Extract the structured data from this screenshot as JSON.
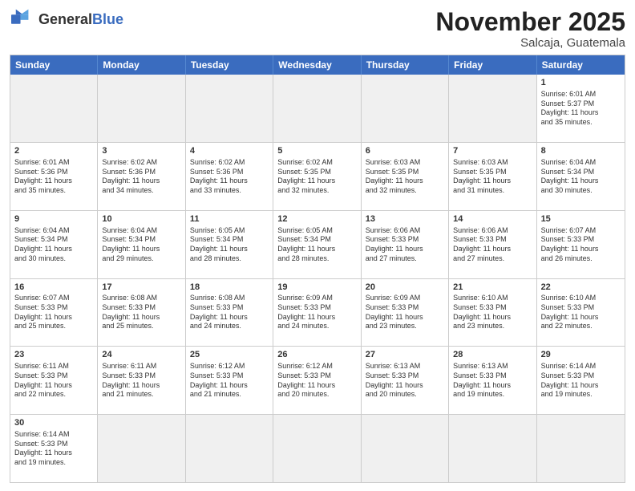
{
  "header": {
    "logo_general": "General",
    "logo_blue": "Blue",
    "month_title": "November 2025",
    "location": "Salcaja, Guatemala"
  },
  "days_of_week": [
    "Sunday",
    "Monday",
    "Tuesday",
    "Wednesday",
    "Thursday",
    "Friday",
    "Saturday"
  ],
  "weeks": [
    [
      {
        "day": "",
        "info": "",
        "shaded": true
      },
      {
        "day": "",
        "info": "",
        "shaded": true
      },
      {
        "day": "",
        "info": "",
        "shaded": true
      },
      {
        "day": "",
        "info": "",
        "shaded": true
      },
      {
        "day": "",
        "info": "",
        "shaded": true
      },
      {
        "day": "",
        "info": "",
        "shaded": true
      },
      {
        "day": "1",
        "info": "Sunrise: 6:01 AM\nSunset: 5:37 PM\nDaylight: 11 hours\nand 35 minutes.",
        "shaded": false
      }
    ],
    [
      {
        "day": "2",
        "info": "Sunrise: 6:01 AM\nSunset: 5:36 PM\nDaylight: 11 hours\nand 35 minutes.",
        "shaded": false
      },
      {
        "day": "3",
        "info": "Sunrise: 6:02 AM\nSunset: 5:36 PM\nDaylight: 11 hours\nand 34 minutes.",
        "shaded": false
      },
      {
        "day": "4",
        "info": "Sunrise: 6:02 AM\nSunset: 5:36 PM\nDaylight: 11 hours\nand 33 minutes.",
        "shaded": false
      },
      {
        "day": "5",
        "info": "Sunrise: 6:02 AM\nSunset: 5:35 PM\nDaylight: 11 hours\nand 32 minutes.",
        "shaded": false
      },
      {
        "day": "6",
        "info": "Sunrise: 6:03 AM\nSunset: 5:35 PM\nDaylight: 11 hours\nand 32 minutes.",
        "shaded": false
      },
      {
        "day": "7",
        "info": "Sunrise: 6:03 AM\nSunset: 5:35 PM\nDaylight: 11 hours\nand 31 minutes.",
        "shaded": false
      },
      {
        "day": "8",
        "info": "Sunrise: 6:04 AM\nSunset: 5:34 PM\nDaylight: 11 hours\nand 30 minutes.",
        "shaded": false
      }
    ],
    [
      {
        "day": "9",
        "info": "Sunrise: 6:04 AM\nSunset: 5:34 PM\nDaylight: 11 hours\nand 30 minutes.",
        "shaded": false
      },
      {
        "day": "10",
        "info": "Sunrise: 6:04 AM\nSunset: 5:34 PM\nDaylight: 11 hours\nand 29 minutes.",
        "shaded": false
      },
      {
        "day": "11",
        "info": "Sunrise: 6:05 AM\nSunset: 5:34 PM\nDaylight: 11 hours\nand 28 minutes.",
        "shaded": false
      },
      {
        "day": "12",
        "info": "Sunrise: 6:05 AM\nSunset: 5:34 PM\nDaylight: 11 hours\nand 28 minutes.",
        "shaded": false
      },
      {
        "day": "13",
        "info": "Sunrise: 6:06 AM\nSunset: 5:33 PM\nDaylight: 11 hours\nand 27 minutes.",
        "shaded": false
      },
      {
        "day": "14",
        "info": "Sunrise: 6:06 AM\nSunset: 5:33 PM\nDaylight: 11 hours\nand 27 minutes.",
        "shaded": false
      },
      {
        "day": "15",
        "info": "Sunrise: 6:07 AM\nSunset: 5:33 PM\nDaylight: 11 hours\nand 26 minutes.",
        "shaded": false
      }
    ],
    [
      {
        "day": "16",
        "info": "Sunrise: 6:07 AM\nSunset: 5:33 PM\nDaylight: 11 hours\nand 25 minutes.",
        "shaded": false
      },
      {
        "day": "17",
        "info": "Sunrise: 6:08 AM\nSunset: 5:33 PM\nDaylight: 11 hours\nand 25 minutes.",
        "shaded": false
      },
      {
        "day": "18",
        "info": "Sunrise: 6:08 AM\nSunset: 5:33 PM\nDaylight: 11 hours\nand 24 minutes.",
        "shaded": false
      },
      {
        "day": "19",
        "info": "Sunrise: 6:09 AM\nSunset: 5:33 PM\nDaylight: 11 hours\nand 24 minutes.",
        "shaded": false
      },
      {
        "day": "20",
        "info": "Sunrise: 6:09 AM\nSunset: 5:33 PM\nDaylight: 11 hours\nand 23 minutes.",
        "shaded": false
      },
      {
        "day": "21",
        "info": "Sunrise: 6:10 AM\nSunset: 5:33 PM\nDaylight: 11 hours\nand 23 minutes.",
        "shaded": false
      },
      {
        "day": "22",
        "info": "Sunrise: 6:10 AM\nSunset: 5:33 PM\nDaylight: 11 hours\nand 22 minutes.",
        "shaded": false
      }
    ],
    [
      {
        "day": "23",
        "info": "Sunrise: 6:11 AM\nSunset: 5:33 PM\nDaylight: 11 hours\nand 22 minutes.",
        "shaded": false
      },
      {
        "day": "24",
        "info": "Sunrise: 6:11 AM\nSunset: 5:33 PM\nDaylight: 11 hours\nand 21 minutes.",
        "shaded": false
      },
      {
        "day": "25",
        "info": "Sunrise: 6:12 AM\nSunset: 5:33 PM\nDaylight: 11 hours\nand 21 minutes.",
        "shaded": false
      },
      {
        "day": "26",
        "info": "Sunrise: 6:12 AM\nSunset: 5:33 PM\nDaylight: 11 hours\nand 20 minutes.",
        "shaded": false
      },
      {
        "day": "27",
        "info": "Sunrise: 6:13 AM\nSunset: 5:33 PM\nDaylight: 11 hours\nand 20 minutes.",
        "shaded": false
      },
      {
        "day": "28",
        "info": "Sunrise: 6:13 AM\nSunset: 5:33 PM\nDaylight: 11 hours\nand 19 minutes.",
        "shaded": false
      },
      {
        "day": "29",
        "info": "Sunrise: 6:14 AM\nSunset: 5:33 PM\nDaylight: 11 hours\nand 19 minutes.",
        "shaded": false
      }
    ],
    [
      {
        "day": "30",
        "info": "Sunrise: 6:14 AM\nSunset: 5:33 PM\nDaylight: 11 hours\nand 19 minutes.",
        "shaded": false
      },
      {
        "day": "",
        "info": "",
        "shaded": true
      },
      {
        "day": "",
        "info": "",
        "shaded": true
      },
      {
        "day": "",
        "info": "",
        "shaded": true
      },
      {
        "day": "",
        "info": "",
        "shaded": true
      },
      {
        "day": "",
        "info": "",
        "shaded": true
      },
      {
        "day": "",
        "info": "",
        "shaded": true
      }
    ]
  ]
}
